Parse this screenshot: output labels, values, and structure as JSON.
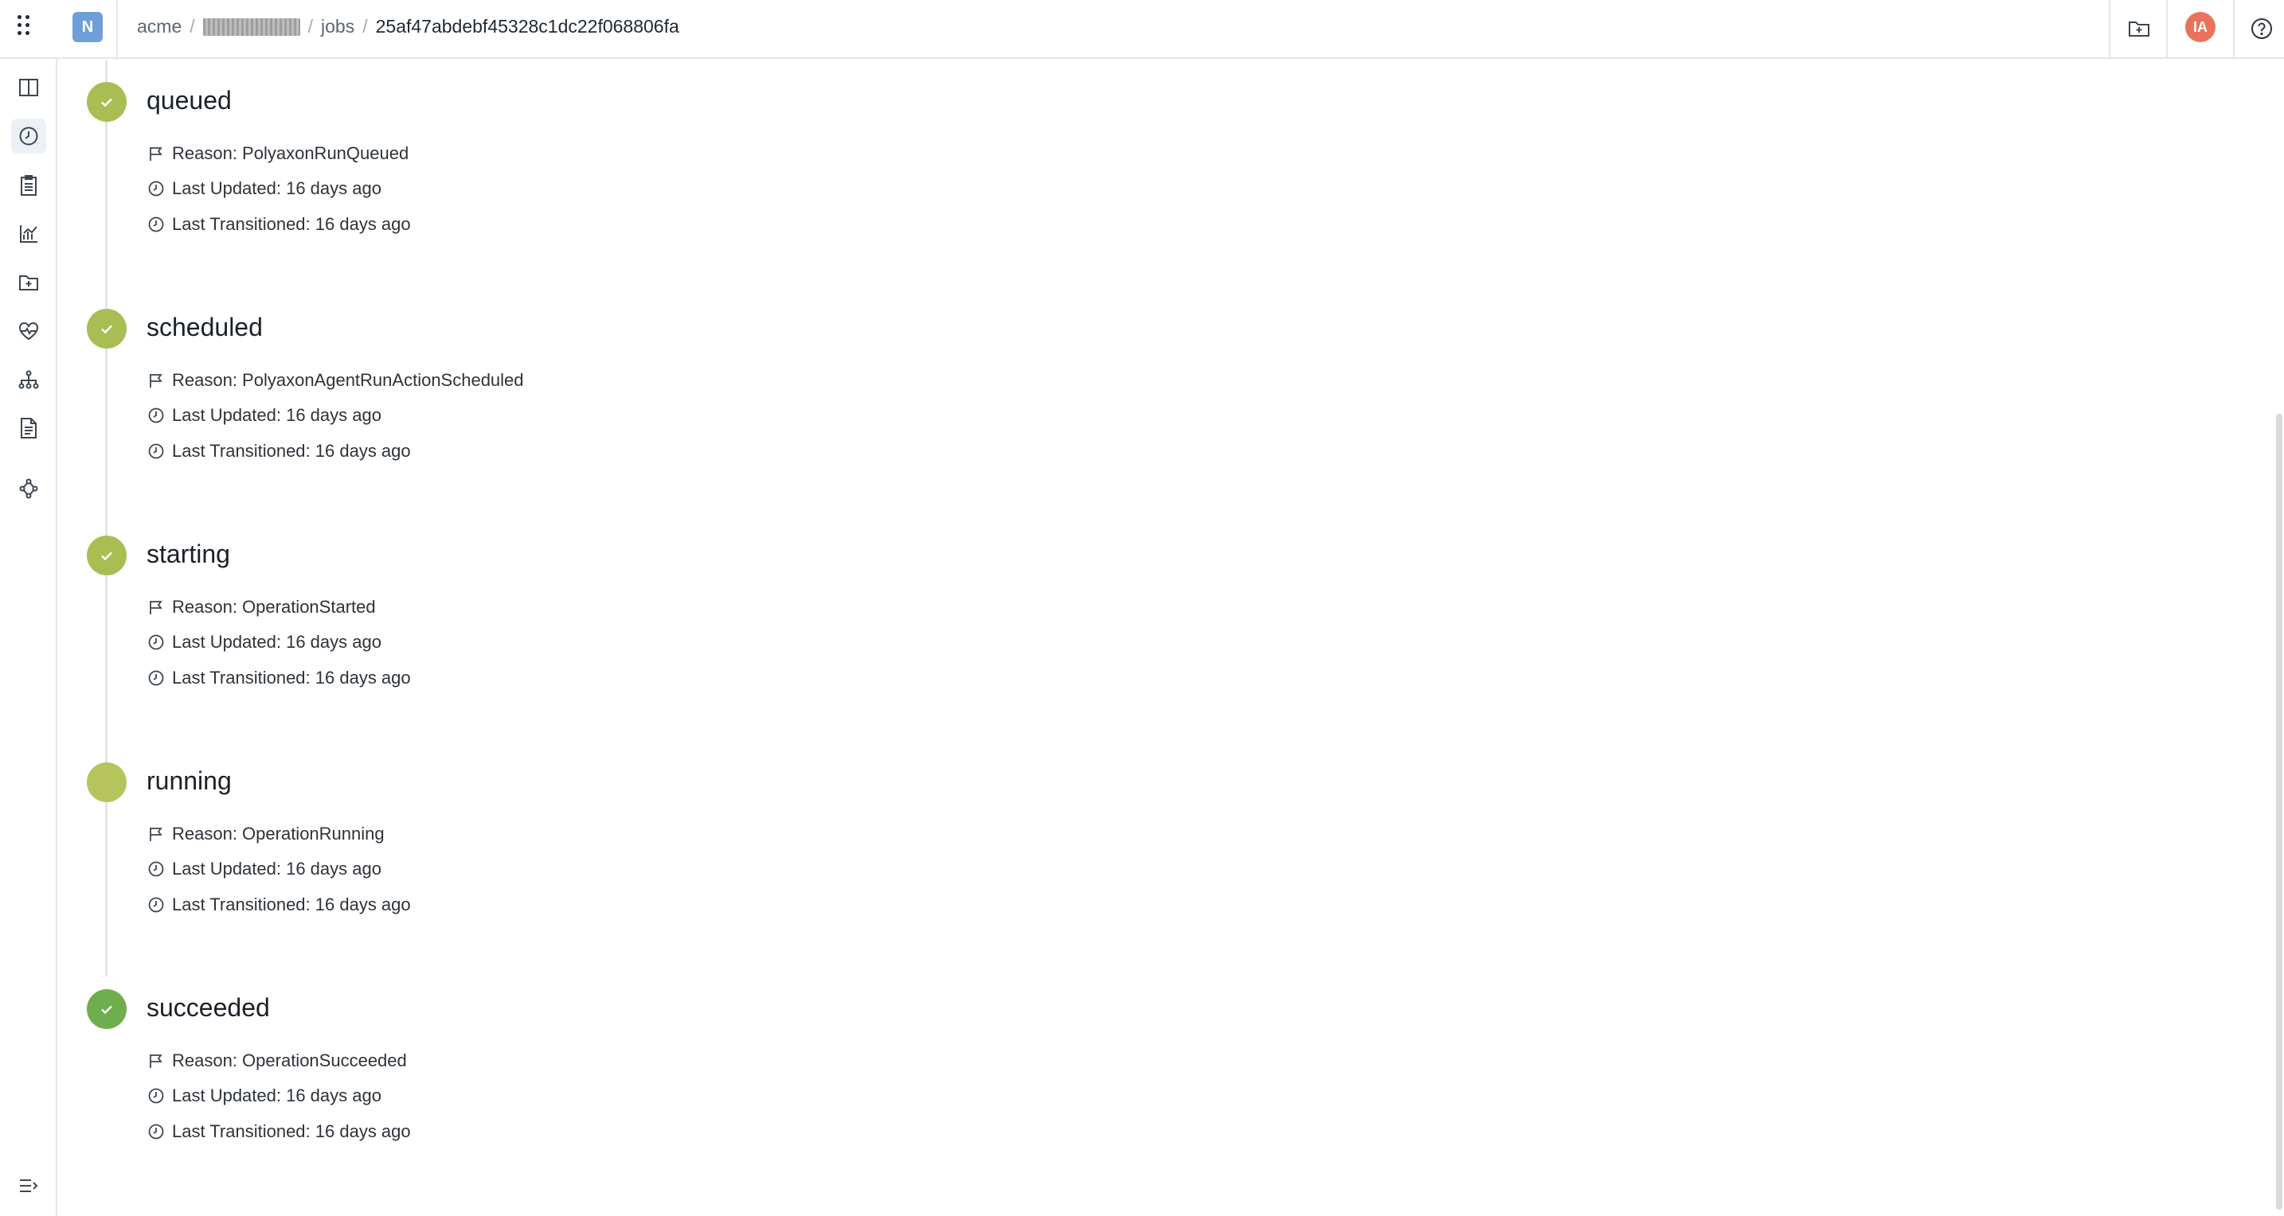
{
  "header": {
    "org_initial": "N",
    "breadcrumb": {
      "org": "acme",
      "project_redacted": "",
      "section": "jobs",
      "run_id": "25af47abdebf45328c1dc22f068806fa"
    },
    "user_initials": "IA"
  },
  "sidebar": {
    "items": [
      {
        "icon": "columns-icon",
        "active": false
      },
      {
        "icon": "clock-icon",
        "active": true
      },
      {
        "icon": "clipboard-icon",
        "active": false
      },
      {
        "icon": "chart-icon",
        "active": false
      },
      {
        "icon": "folder-icon",
        "active": false
      },
      {
        "icon": "heartbeat-icon",
        "active": false
      },
      {
        "icon": "hierarchy-icon",
        "active": false
      },
      {
        "icon": "document-icon",
        "active": false
      },
      {
        "icon": "graph-icon",
        "active": false
      }
    ],
    "collapse_icon": "menu-collapse-icon"
  },
  "colors": {
    "check_done": "#a9be52",
    "running": "#b6c45e",
    "succeeded": "#6fae4c"
  },
  "stages": [
    {
      "title": "queued",
      "status": "done",
      "reason": "Reason: PolyaxonRunQueued",
      "last_updated": "Last Updated: 16 days ago",
      "last_transitioned": "Last Transitioned: 16 days ago"
    },
    {
      "title": "scheduled",
      "status": "done",
      "reason": "Reason: PolyaxonAgentRunActionScheduled",
      "last_updated": "Last Updated: 16 days ago",
      "last_transitioned": "Last Transitioned: 16 days ago"
    },
    {
      "title": "starting",
      "status": "done",
      "reason": "Reason: OperationStarted",
      "last_updated": "Last Updated: 16 days ago",
      "last_transitioned": "Last Transitioned: 16 days ago"
    },
    {
      "title": "running",
      "status": "running",
      "reason": "Reason: OperationRunning",
      "last_updated": "Last Updated: 16 days ago",
      "last_transitioned": "Last Transitioned: 16 days ago"
    },
    {
      "title": "succeeded",
      "status": "succeeded",
      "reason": "Reason: OperationSucceeded",
      "last_updated": "Last Updated: 16 days ago",
      "last_transitioned": "Last Transitioned: 16 days ago"
    }
  ]
}
